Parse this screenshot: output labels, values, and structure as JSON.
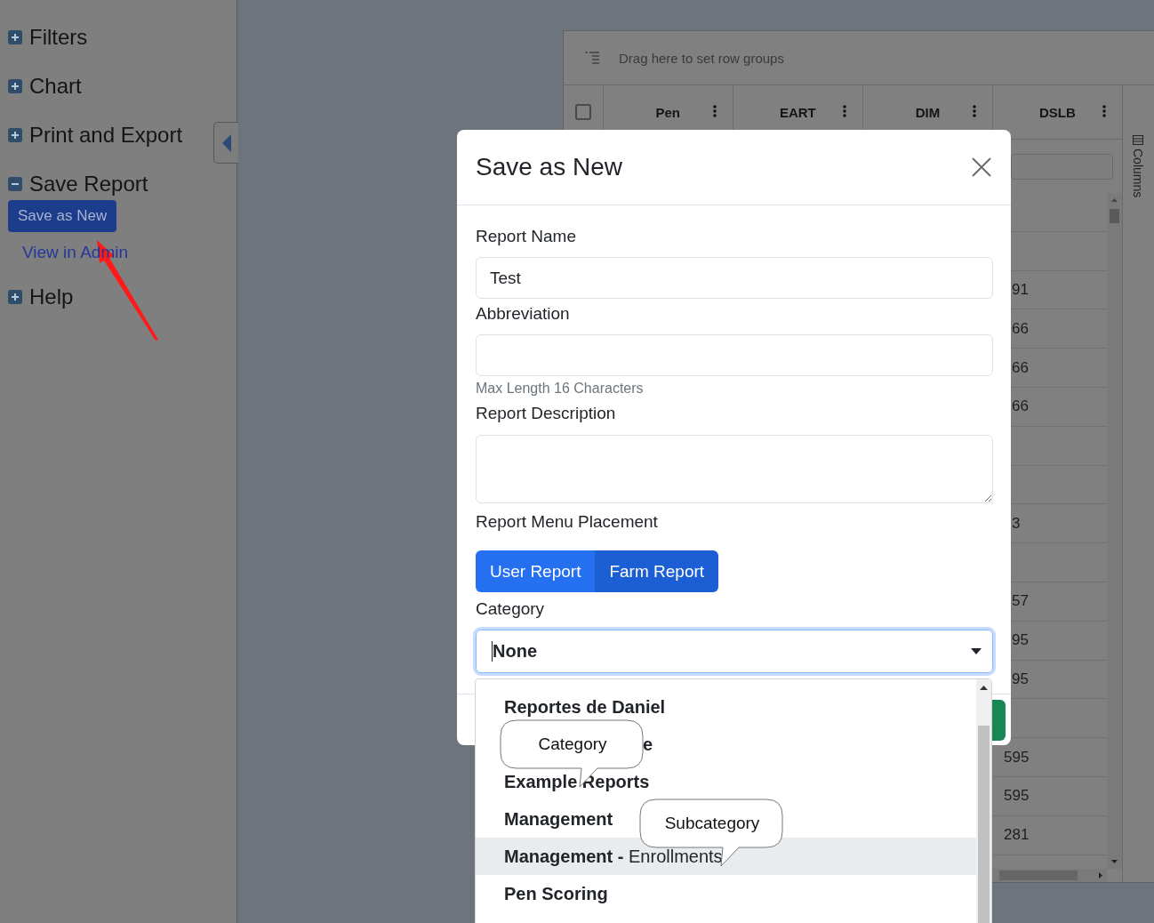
{
  "sidebar": {
    "items": [
      {
        "label": "Filters",
        "expanded": false
      },
      {
        "label": "Chart",
        "expanded": false
      },
      {
        "label": "Print and Export",
        "expanded": false
      },
      {
        "label": "Save Report",
        "expanded": true,
        "actions": [
          {
            "kind": "button",
            "label": "Save as New"
          },
          {
            "kind": "link",
            "label": "View in Admin"
          }
        ]
      },
      {
        "label": "Help",
        "expanded": false
      }
    ]
  },
  "grid": {
    "group_bar": "Drag here to set row groups",
    "columns": [
      "Pen",
      "EART",
      "DIM",
      "DSLB"
    ],
    "select_all_checked": false,
    "side_panel": "Columns",
    "rows": [
      null,
      null,
      "91",
      "66",
      "66",
      "66",
      null,
      null,
      "3",
      null,
      "57",
      "95",
      "95",
      null,
      "595",
      "595",
      "281"
    ]
  },
  "modal": {
    "title": "Save as New",
    "fields": [
      {
        "kind": "input",
        "label": "Report Name",
        "value": "Test"
      },
      {
        "kind": "input",
        "label": "Abbreviation",
        "hint": "Max Length 16 Characters"
      },
      {
        "kind": "textarea",
        "label": "Report Description"
      },
      {
        "kind": "toggle",
        "label": "Report Menu Placement",
        "options": [
          {
            "label": "User Report",
            "selected": false
          },
          {
            "label": "Farm Report",
            "selected": true
          }
        ]
      },
      {
        "kind": "select",
        "label": "Category",
        "value": "None",
        "focused": true
      }
    ],
    "dropdown": [
      {
        "label": "Reportes de Daniel",
        "highlighted": false
      },
      {
        "label": "e",
        "kind": "covered",
        "highlighted": false
      },
      {
        "label": "Example Reports",
        "highlighted": false
      },
      {
        "label": "Management",
        "highlighted": false
      },
      {
        "label": "**Management -** Enrollments",
        "highlighted": true
      },
      {
        "label": "Pen Scoring",
        "highlighted": false
      }
    ]
  },
  "callouts": [
    "Category",
    "Subcategory"
  ]
}
